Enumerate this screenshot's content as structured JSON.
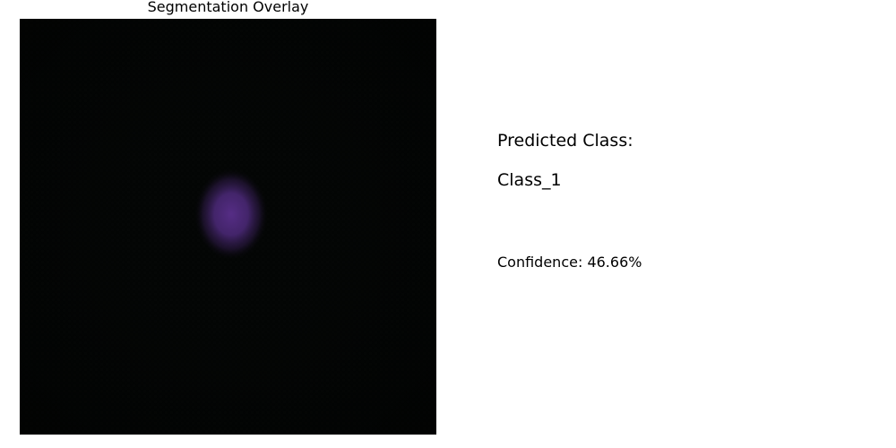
{
  "overlay": {
    "title": "Segmentation Overlay"
  },
  "prediction": {
    "label": "Predicted Class:",
    "class_name": "Class_1",
    "confidence_text": "Confidence: 46.66%"
  },
  "colors": {
    "background": "#020403",
    "blob": "#5a2f8c"
  }
}
